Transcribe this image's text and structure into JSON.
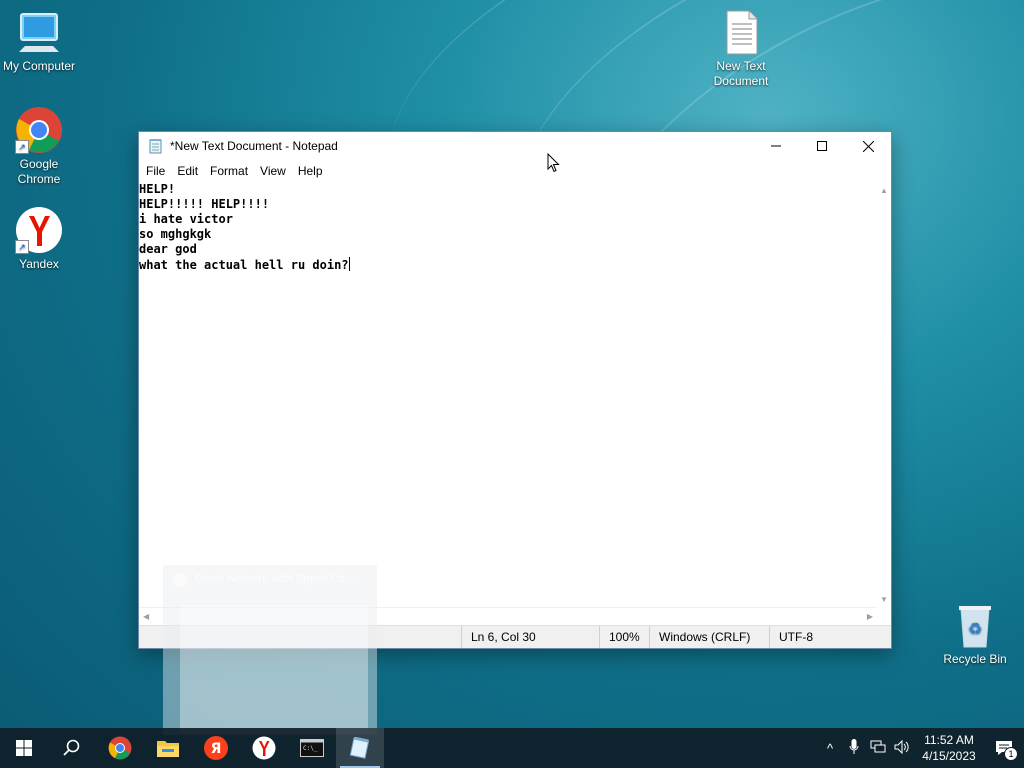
{
  "desktop": {
    "icons": [
      {
        "label": "My Computer"
      },
      {
        "label": "Google Chrome"
      },
      {
        "label": "Yandex"
      },
      {
        "label": "New Text Document"
      },
      {
        "label": "Recycle Bin"
      }
    ]
  },
  "notepad": {
    "title": "*New Text Document - Notepad",
    "menu": [
      "File",
      "Edit",
      "Format",
      "View",
      "Help"
    ],
    "lines": [
      "HELP!",
      "HELP!!!!! HELP!!!!",
      "i hate victor",
      "so mghgkgk",
      "dear god",
      "what the actual hell ru doin?"
    ],
    "status": {
      "position": "Ln 6, Col 30",
      "zoom": "100%",
      "line_ending": "Windows (CRLF)",
      "encoding": "UTF-8"
    }
  },
  "ghost_preview": {
    "title": "Ommi Network With Speed Co..."
  },
  "taskbar": {
    "apps": [
      "start-icon",
      "search-icon",
      "chrome-icon",
      "file-explorer-icon",
      "yandex-browser-icon",
      "yandex-icon",
      "terminal-icon",
      "notepad-icon"
    ],
    "clock_time": "11:52 AM",
    "clock_date": "4/15/2023",
    "notification_count": "1"
  },
  "colors": {
    "accent": "#0078d7",
    "taskbar": "#101e28",
    "desktop": "#0f6f88"
  }
}
